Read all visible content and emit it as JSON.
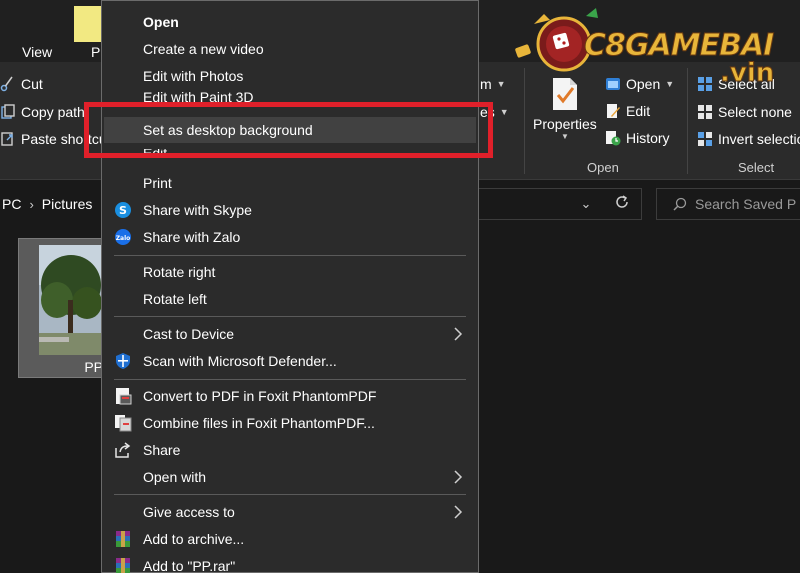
{
  "ribbon": {
    "tabs": {
      "view": "View",
      "share": "P"
    },
    "clipboard": {
      "cut": "Cut",
      "copy_path": "Copy path",
      "paste_shortcut": "Paste shortcut"
    },
    "organize": {
      "move_to": "m",
      "delete": "es"
    },
    "open_group": {
      "properties": "Properties",
      "open": "Open",
      "edit": "Edit",
      "history": "History",
      "label": "Open"
    },
    "select_group": {
      "select_all": "Select all",
      "select_none": "Select none",
      "invert_selection": "Invert selectio",
      "label": "Select"
    }
  },
  "address": {
    "crumbs": [
      "PC",
      "Pictures"
    ],
    "search_placeholder": "Search Saved P"
  },
  "file": {
    "name": "PP"
  },
  "context_menu": {
    "open": "Open",
    "create_new_video": "Create a new video",
    "edit_with_photos": "Edit with Photos",
    "edit_with_paint3d": "Edit with Paint 3D",
    "set_desktop_background": "Set as desktop background",
    "edit": "Edit",
    "print": "Print",
    "share_skype": "Share with Skype",
    "share_zalo": "Share with Zalo",
    "rotate_right": "Rotate right",
    "rotate_left": "Rotate left",
    "cast_to_device": "Cast to Device",
    "scan_defender": "Scan with Microsoft Defender...",
    "convert_pdf": "Convert to PDF in Foxit PhantomPDF",
    "combine_files": "Combine files in Foxit PhantomPDF...",
    "share": "Share",
    "open_with": "Open with",
    "give_access": "Give access to",
    "add_to_archive": "Add to archive...",
    "add_to_rar": "Add to \"PP.rar\""
  },
  "watermark": {
    "brand": "C8GAMEBAI",
    "tld": ".vin"
  },
  "colors": {
    "highlight_box": "#e0202a",
    "menu_bg": "#2b2b2b",
    "hover_bg": "#414141",
    "logo_gold": "#e8b53a"
  }
}
